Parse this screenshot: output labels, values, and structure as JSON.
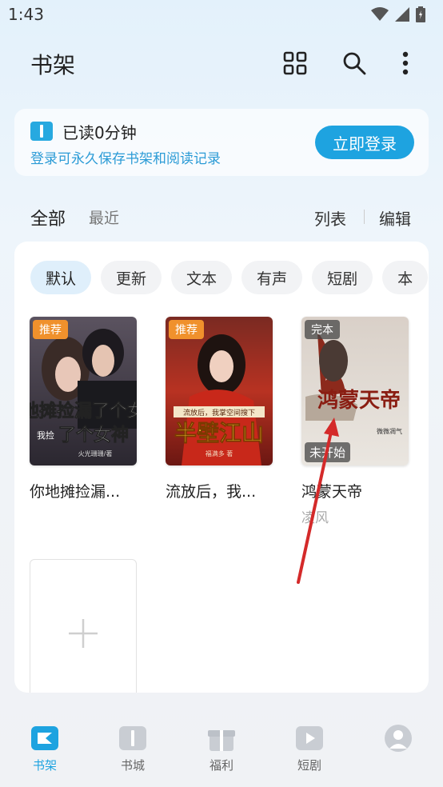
{
  "status": {
    "time": "1:43"
  },
  "header": {
    "title": "书架"
  },
  "login_card": {
    "read_time": "已读0分钟",
    "hint": "登录可永久保存书架和阅读记录",
    "login_button": "立即登录"
  },
  "tabs": {
    "all": "全部",
    "recent": "最近"
  },
  "actions": {
    "list": "列表",
    "edit": "编辑"
  },
  "chips": [
    "默认",
    "更新",
    "文本",
    "有声",
    "短剧",
    "本"
  ],
  "books": [
    {
      "title": "你地摊捡漏...",
      "badge": "推荐",
      "cover_text": "你地摊捡漏了个女神",
      "cover_sub": "我捡",
      "cover_author": "火光珊珊/著",
      "author": ""
    },
    {
      "title": "流放后，我...",
      "badge": "推荐",
      "cover_text": "半壁江山",
      "cover_sub": "流放后，我掌空间搜下",
      "cover_author": "福满多 著",
      "author": ""
    },
    {
      "title": "鸿蒙天帝",
      "badge": "完本",
      "status": "未开始",
      "cover_text": "鸿蒙天帝",
      "cover_author": "微微凋气",
      "author": "凌风"
    }
  ],
  "nav": [
    {
      "label": "书架"
    },
    {
      "label": "书城"
    },
    {
      "label": "福利"
    },
    {
      "label": "短剧"
    },
    {
      "label": ""
    }
  ],
  "colors": {
    "accent": "#1ea3e0",
    "badge_orange": "#f0912c"
  }
}
